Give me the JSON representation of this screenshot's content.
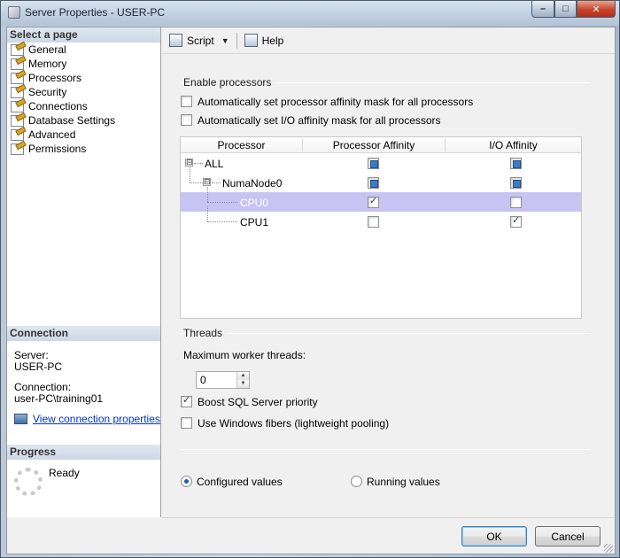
{
  "window": {
    "title": "Server Properties - USER-PC",
    "controls": {
      "minimize": "–",
      "maximize": "□",
      "close": "✕"
    }
  },
  "sidebar": {
    "select_page_header": "Select a page",
    "pages": [
      {
        "label": "General",
        "icon": "wrench-page-icon"
      },
      {
        "label": "Memory",
        "icon": "wrench-page-icon"
      },
      {
        "label": "Processors",
        "icon": "wrench-page-icon",
        "selected": true
      },
      {
        "label": "Security",
        "icon": "wrench-page-icon"
      },
      {
        "label": "Connections",
        "icon": "wrench-page-icon"
      },
      {
        "label": "Database Settings",
        "icon": "wrench-page-icon"
      },
      {
        "label": "Advanced",
        "icon": "wrench-page-icon"
      },
      {
        "label": "Permissions",
        "icon": "wrench-page-icon"
      }
    ],
    "connection_header": "Connection",
    "server_label": "Server:",
    "server_value": "USER-PC",
    "connection_label": "Connection:",
    "connection_value": "user-PC\\training01",
    "view_connection_link": "View connection properties",
    "progress_header": "Progress",
    "progress_status": "Ready"
  },
  "toolbar": {
    "script_label": "Script",
    "help_label": "Help"
  },
  "processors": {
    "enable_group_label": "Enable processors",
    "auto_processor_affinity_label": "Automatically set processor affinity mask for all processors",
    "auto_processor_affinity_checked": false,
    "auto_io_affinity_label": "Automatically set I/O affinity mask for all processors",
    "auto_io_affinity_checked": false,
    "grid": {
      "columns": [
        "Processor",
        "Processor Affinity",
        "I/O Affinity"
      ],
      "rows": [
        {
          "name": "ALL",
          "level": 0,
          "expander": "⊟",
          "processor_affinity": "indeterminate",
          "io_affinity": "indeterminate"
        },
        {
          "name": "NumaNode0",
          "level": 1,
          "expander": "⊟",
          "processor_affinity": "indeterminate",
          "io_affinity": "indeterminate"
        },
        {
          "name": "CPU0",
          "level": 2,
          "processor_affinity": "checked",
          "io_affinity": "unchecked",
          "selected": true
        },
        {
          "name": "CPU1",
          "level": 2,
          "processor_affinity": "unchecked",
          "io_affinity": "checked"
        }
      ]
    }
  },
  "threads": {
    "group_label": "Threads",
    "max_worker_threads_label": "Maximum worker threads:",
    "max_worker_threads_value": "0",
    "boost_priority_label": "Boost SQL Server priority",
    "boost_priority_checked": true,
    "windows_fibers_label": "Use Windows fibers (lightweight pooling)",
    "windows_fibers_checked": false
  },
  "values_mode": {
    "configured_label": "Configured  values",
    "running_label": "Running values",
    "selected": "configured"
  },
  "buttons": {
    "ok_label": "OK",
    "cancel_label": "Cancel"
  }
}
